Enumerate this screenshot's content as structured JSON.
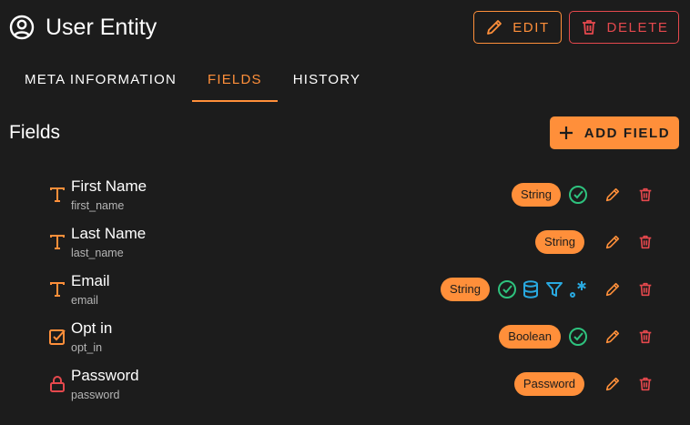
{
  "header": {
    "title": "User Entity",
    "edit_label": "EDIT",
    "delete_label": "DELETE"
  },
  "tabs": [
    {
      "label": "META INFORMATION",
      "active": false
    },
    {
      "label": "FIELDS",
      "active": true
    },
    {
      "label": "HISTORY",
      "active": false
    }
  ],
  "section": {
    "title": "Fields",
    "add_label": "ADD FIELD"
  },
  "fields": [
    {
      "name": "First Name",
      "key": "first_name",
      "type_icon": "text-type-icon",
      "type": "String",
      "flags": [
        "required-icon"
      ]
    },
    {
      "name": "Last Name",
      "key": "last_name",
      "type_icon": "text-type-icon",
      "type": "String",
      "flags": []
    },
    {
      "name": "Email",
      "key": "email",
      "type_icon": "text-type-icon",
      "type": "String",
      "flags": [
        "required-icon",
        "database-icon",
        "filter-icon",
        "regex-icon"
      ]
    },
    {
      "name": "Opt in",
      "key": "opt_in",
      "type_icon": "checkbox-type-icon",
      "type": "Boolean",
      "flags": [
        "required-icon"
      ]
    },
    {
      "name": "Password",
      "key": "password",
      "type_icon": "lock-type-icon",
      "type": "Password",
      "flags": []
    }
  ],
  "colors": {
    "accent": "#ff8f3a",
    "danger": "#e5484d",
    "success": "#2ec27e",
    "info": "#29a9e0",
    "background": "#1c1c1c"
  }
}
